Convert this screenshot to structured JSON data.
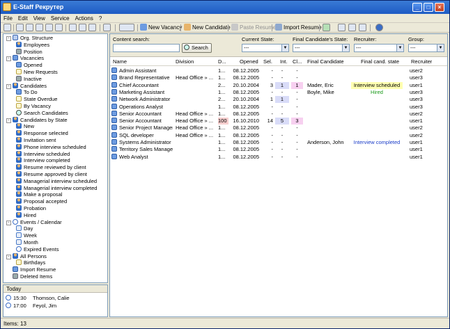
{
  "window": {
    "title": "E-Staff Рекрутер"
  },
  "menu": [
    "File",
    "Edit",
    "View",
    "Service",
    "Actions",
    "?"
  ],
  "toolbar": {
    "new_vacancy": "New Vacancy",
    "new_candidate": "New Candidate",
    "paste_resume": "Paste Resume",
    "import_resume": "Import Resume"
  },
  "tree": [
    {
      "label": "Org. Structure",
      "level": 0,
      "icon": "org",
      "exp": "-"
    },
    {
      "label": "Employees",
      "level": 1,
      "icon": "person"
    },
    {
      "label": "Position",
      "level": 1,
      "icon": "gear"
    },
    {
      "label": "Vacancies",
      "level": 0,
      "icon": "folder",
      "exp": "-"
    },
    {
      "label": "Opened",
      "level": 1,
      "icon": "folder"
    },
    {
      "label": "New Requests",
      "level": 1,
      "icon": "doc"
    },
    {
      "label": "Inactive",
      "level": 1,
      "icon": "gear"
    },
    {
      "label": "Candidates",
      "level": 0,
      "icon": "person",
      "exp": "-"
    },
    {
      "label": "To Do",
      "level": 1,
      "icon": "folder"
    },
    {
      "label": "State Overdue",
      "level": 1,
      "icon": "doc"
    },
    {
      "label": "By Vacancy",
      "level": 1,
      "icon": "doc"
    },
    {
      "label": "Search Candidates",
      "level": 1,
      "icon": "search"
    },
    {
      "label": "Candidates by State",
      "level": 0,
      "icon": "person",
      "exp": "-"
    },
    {
      "label": "New",
      "level": 1,
      "icon": "person"
    },
    {
      "label": "Response selected",
      "level": 1,
      "icon": "person"
    },
    {
      "label": "Invitation sent",
      "level": 1,
      "icon": "person"
    },
    {
      "label": "Phone interview scheduled",
      "level": 1,
      "icon": "person"
    },
    {
      "label": "Interview scheduled",
      "level": 1,
      "icon": "person"
    },
    {
      "label": "Interview completed",
      "level": 1,
      "icon": "person"
    },
    {
      "label": "Resume reviewed by client",
      "level": 1,
      "icon": "person"
    },
    {
      "label": "Resume approved by client",
      "level": 1,
      "icon": "person"
    },
    {
      "label": "Managerial interview scheduled",
      "level": 1,
      "icon": "person"
    },
    {
      "label": "Managerial interview completed",
      "level": 1,
      "icon": "person"
    },
    {
      "label": "Make a proposal",
      "level": 1,
      "icon": "person"
    },
    {
      "label": "Proposal accepted",
      "level": 1,
      "icon": "person"
    },
    {
      "label": "Probation",
      "level": 1,
      "icon": "person"
    },
    {
      "label": "Hired",
      "level": 1,
      "icon": "person"
    },
    {
      "label": "Events / Calendar",
      "level": 0,
      "icon": "clock",
      "exp": "-"
    },
    {
      "label": "Day",
      "level": 1,
      "icon": "cal"
    },
    {
      "label": "Week",
      "level": 1,
      "icon": "cal"
    },
    {
      "label": "Month",
      "level": 1,
      "icon": "cal"
    },
    {
      "label": "Expired Events",
      "level": 1,
      "icon": "clock"
    },
    {
      "label": "All Persons",
      "level": 0,
      "icon": "person",
      "exp": "-"
    },
    {
      "label": "Birthdays",
      "level": 1,
      "icon": "doc"
    },
    {
      "label": "Import Resume",
      "level": 0,
      "icon": "folder"
    },
    {
      "label": "Deleted Items",
      "level": 0,
      "icon": "gear"
    }
  ],
  "today": {
    "header": "Today",
    "events": [
      {
        "time": "15:30",
        "name": "Thomson, Calie"
      },
      {
        "time": "17:00",
        "name": "Feyol, Jim"
      }
    ]
  },
  "filters": {
    "content_search_label": "Content search:",
    "search_button": "Search",
    "current_state_label": "Current State:",
    "current_state_value": "---",
    "final_state_label": "Final Candidate's State:",
    "final_state_value": "---",
    "recruiter_label": "Recruiter:",
    "recruiter_value": "---",
    "group_label": "Group:",
    "group_value": "---"
  },
  "columns": [
    "Name",
    "Division",
    "D...",
    "Opened",
    "Sel.",
    "Int.",
    "Cl...",
    "Final Candidate",
    "Final cand. state",
    "Recruiter"
  ],
  "rows": [
    {
      "name": "Admin Assistant",
      "division": "",
      "d": "1...",
      "opened": "08.12.2005",
      "sel": "-",
      "int": "-",
      "cl": "-",
      "final": "",
      "state": "",
      "recruiter": "user2"
    },
    {
      "name": "Brand Representative",
      "division": "Head Office » ...",
      "d": "1...",
      "opened": "08.12.2005",
      "sel": "-",
      "int": "-",
      "cl": "-",
      "final": "",
      "state": "",
      "recruiter": "user3"
    },
    {
      "name": "Chief Accountant",
      "division": "",
      "d": "2...",
      "opened": "20.10.2004",
      "sel": "3",
      "int": "1",
      "cl": "1",
      "final": "Mader, Eric",
      "state": "Interview scheduled",
      "recruiter": "user1"
    },
    {
      "name": "Marketing Assistant",
      "division": "",
      "d": "1...",
      "opened": "08.12.2005",
      "sel": "-",
      "int": "-",
      "cl": "-",
      "final": "Boyle, Mike",
      "state": "Hired",
      "recruiter": "user3"
    },
    {
      "name": "Network Administrator",
      "division": "",
      "d": "2...",
      "opened": "20.10.2004",
      "sel": "1",
      "int": "1",
      "cl": "-",
      "final": "",
      "state": "",
      "recruiter": "user3"
    },
    {
      "name": "Operations Analyst",
      "division": "",
      "d": "1...",
      "opened": "08.12.2005",
      "sel": "-",
      "int": "-",
      "cl": "-",
      "final": "",
      "state": "",
      "recruiter": "user3"
    },
    {
      "name": "Senior Accountant",
      "division": "Head Office » ...",
      "d": "1...",
      "opened": "08.12.2005",
      "sel": "-",
      "int": "-",
      "cl": "-",
      "final": "",
      "state": "",
      "recruiter": "user2"
    },
    {
      "name": "Senior Accountant",
      "division": "Head Office » ...",
      "d": "100",
      "opened": "16.10.2010",
      "sel": "14",
      "int": "5",
      "cl": "3",
      "final": "",
      "state": "",
      "recruiter": "user1"
    },
    {
      "name": "Senior Project Manager - ...",
      "division": "Head Office » ...",
      "d": "1...",
      "opened": "08.12.2005",
      "sel": "-",
      "int": "-",
      "cl": "-",
      "final": "",
      "state": "",
      "recruiter": "user2"
    },
    {
      "name": "SQL developer",
      "division": "Head Office » ...",
      "d": "1...",
      "opened": "08.12.2005",
      "sel": "-",
      "int": "-",
      "cl": "-",
      "final": "",
      "state": "",
      "recruiter": "user2"
    },
    {
      "name": "Systems Administrator",
      "division": "",
      "d": "1...",
      "opened": "08.12.2005",
      "sel": "-",
      "int": "-",
      "cl": "-",
      "final": "Anderson, John",
      "state": "Interview completed",
      "recruiter": "user1"
    },
    {
      "name": "Territory Sales Manager",
      "division": "",
      "d": "1...",
      "opened": "08.12.2005",
      "sel": "-",
      "int": "-",
      "cl": "-",
      "final": "",
      "state": "",
      "recruiter": "user1"
    },
    {
      "name": "Web Analyst",
      "division": "",
      "d": "1...",
      "opened": "08.12.2005",
      "sel": "-",
      "int": "-",
      "cl": "-",
      "final": "",
      "state": "",
      "recruiter": "user1"
    }
  ],
  "status": {
    "items": "Items: 13"
  },
  "colors": {
    "title_blue": "#1d5bc4",
    "hired_green": "#1a9a1a",
    "completed_blue": "#1a3cc8",
    "highlight_yellow": "#ffffb0"
  }
}
